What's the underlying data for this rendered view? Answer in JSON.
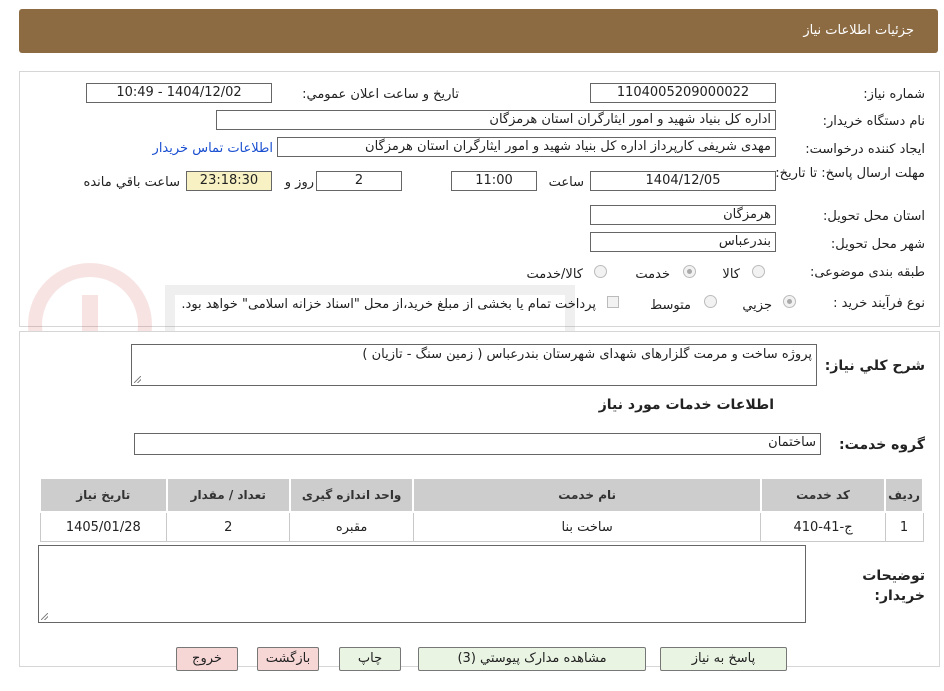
{
  "header": {
    "title": "جزئیات اطلاعات نیاز"
  },
  "form": {
    "need_number_label": "شماره نیاز:",
    "need_number": "1104005209000022",
    "announce_label": "تاریخ و ساعت اعلان عمومي:",
    "announce_value": "1404/12/02 - 10:49",
    "buyer_org_label": "نام دستگاه خريدار:",
    "buyer_org": "اداره کل بنیاد شهید و امور ایثارگران استان هرمزگان",
    "creator_label": "ايجاد کننده درخواست:",
    "creator": "مهدی شریفی کارپرداز اداره کل بنیاد شهید و امور ایثارگران استان هرمزگان",
    "contact_link": "اطلاعات تماس خريدار",
    "deadline_label": "مهلت ارسال پاسخ: تا تاريخ:",
    "deadline_date": "1404/12/05",
    "time_label": "ساعت",
    "deadline_time": "11:00",
    "days_value": "2",
    "day_and_label": "روز و",
    "remaining_time": "23:18:30",
    "remaining_label": "ساعت باقي مانده",
    "province_label": "استان محل تحويل:",
    "province": "هرمزگان",
    "city_label": "شهر محل تحويل:",
    "city": "بندرعباس",
    "category_label": "طبقه بندی موضوعی:",
    "category_options": [
      "کالا",
      "خدمت",
      "کالا/خدمت"
    ],
    "category_selected": "خدمت",
    "process_label": "نوع فرآيند خريد :",
    "process_options": [
      "جزيي",
      "متوسط"
    ],
    "process_selected": "جزيي",
    "treasury_note": "پرداخت تمام یا بخشی از مبلغ خرید،از محل \"اسناد خزانه اسلامی\" خواهد بود."
  },
  "description": {
    "label": "شرح کلي نياز:",
    "text": "پروژه ساخت و مرمت گلزارهای شهدای شهرستان بندرعباس ( زمین سنگ - تازیان )"
  },
  "services": {
    "section_title": "اطلاعات خدمات مورد نياز",
    "group_label": "گروه خدمت:",
    "group_value": "ساختمان",
    "columns": [
      "رديف",
      "کد خدمت",
      "نام خدمت",
      "واحد اندازه گيری",
      "تعداد / مقدار",
      "تاريخ نياز"
    ],
    "rows": [
      [
        "1",
        "ج-41-410",
        "ساخت بنا",
        "مقبره",
        "2",
        "1405/01/28"
      ]
    ]
  },
  "buyer_notes": {
    "label": "توضيحات خريدار:",
    "text": ""
  },
  "buttons": {
    "reply": "پاسخ به نياز",
    "view_docs": "مشاهده مدارک پيوستي (3)",
    "print": "چاپ",
    "back": "بازگشت",
    "exit": "خروج"
  },
  "colors": {
    "header_bg": "#8c6b43",
    "button_green": "#e9f4e3",
    "button_red": "#f7d6d6",
    "timer_bg": "#f7f1c3",
    "link": "#1a4fd1"
  }
}
